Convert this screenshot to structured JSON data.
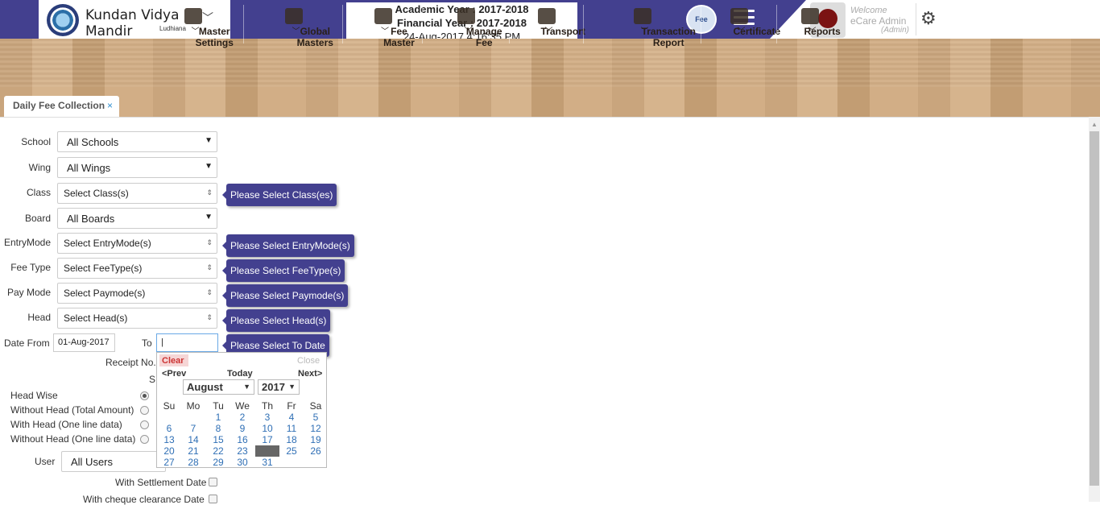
{
  "header": {
    "school_name": "Kundan Vidya Mandir",
    "school_city": "Ludhiana",
    "academic_year": "Academic Year : 2017-2018",
    "financial_year": "Financial Year : 2017-2018",
    "datetime": "24-Aug-2017 4:16:35 PM",
    "fee_logo_text": "Fee",
    "welcome": "Welcome",
    "admin_name": "eCare Admin",
    "admin_role": "(Admin)"
  },
  "nav": [
    {
      "label": "Master Settings",
      "icon": "user-edit-icon"
    },
    {
      "label": "Global Masters",
      "icon": "handshake-icon"
    },
    {
      "label": "Fee Master",
      "icon": "money-icon"
    },
    {
      "label": "Manage Fee",
      "icon": "money-icon"
    },
    {
      "label": "Transport",
      "icon": "bus-icon"
    },
    {
      "label": "Transaction Report",
      "icon": "report-icon"
    },
    {
      "label": "Certificate",
      "icon": "award-icon"
    },
    {
      "label": "Reports",
      "icon": "report-icon"
    }
  ],
  "tab": {
    "label": "Daily Fee Collection",
    "close": "×"
  },
  "form": {
    "school_label": "School",
    "school_value": "All Schools",
    "wing_label": "Wing",
    "wing_value": "All Wings",
    "class_label": "Class",
    "class_value": "Select Class(s)",
    "class_tip": "Please Select Class(es)",
    "board_label": "Board",
    "board_value": "All Boards",
    "entrymode_label": "EntryMode",
    "entrymode_value": "Select EntryMode(s)",
    "entrymode_tip": "Please Select EntryMode(s)",
    "feetype_label": "Fee Type",
    "feetype_value": "Select FeeType(s)",
    "feetype_tip": "Please Select FeeType(s)",
    "paymode_label": "Pay Mode",
    "paymode_value": "Select Paymode(s)",
    "paymode_tip": "Please Select Paymode(s)",
    "head_label": "Head",
    "head_value": "Select Head(s)",
    "head_tip": "Please Select Head(s)",
    "datefrom_label": "Date From",
    "datefrom_value": "01-Aug-2017",
    "to_label": "To",
    "to_value": "",
    "to_tip": "Please Select To Date",
    "receipt_label": "Receipt No.",
    "s_label": "S",
    "radio_options": [
      {
        "label": "Head Wise",
        "checked": true
      },
      {
        "label": "Without Head (Total Amount)",
        "checked": false
      },
      {
        "label": "With Head (One line data)",
        "checked": false
      },
      {
        "label": "Without Head (One line data)",
        "checked": false
      }
    ],
    "user_label": "User",
    "user_value": "All Users",
    "settlement_label": "With Settlement Date",
    "cheque_label": "With cheque clearance Date"
  },
  "calendar": {
    "clear": "Clear",
    "close": "Close",
    "prev": "<Prev",
    "today": "Today",
    "next": "Next>",
    "month": "August",
    "year": "2017",
    "weekdays": [
      "Su",
      "Mo",
      "Tu",
      "We",
      "Th",
      "Fr",
      "Sa"
    ],
    "first_weekday_index": 2,
    "days_in_month": 31,
    "selected_day": 24
  }
}
